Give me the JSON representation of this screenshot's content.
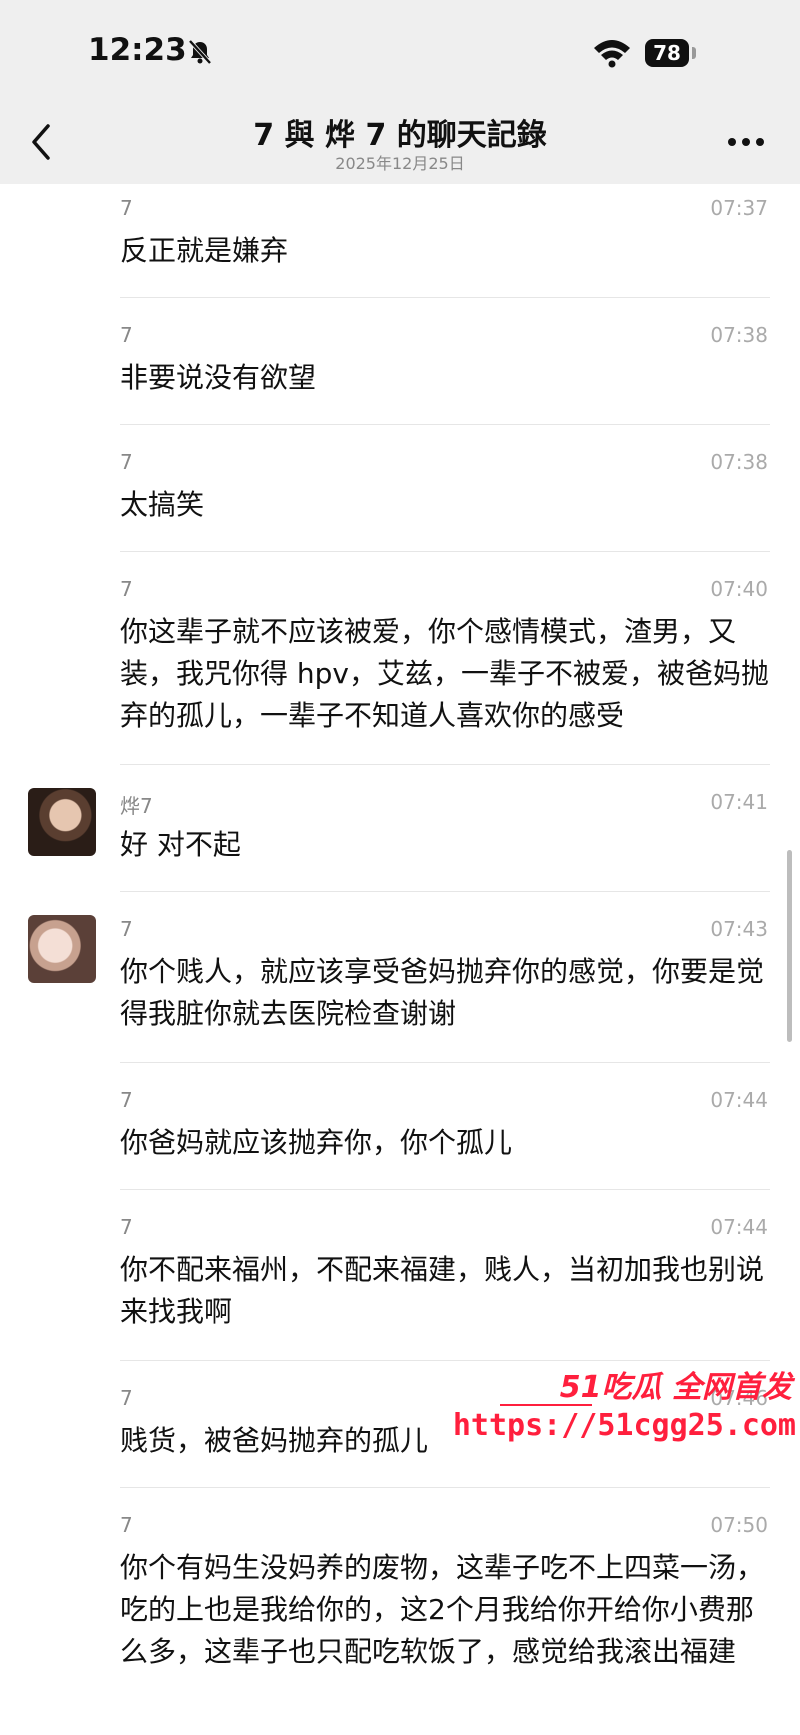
{
  "status_bar": {
    "time": "12:23",
    "battery": "78"
  },
  "header": {
    "title": "7 與 烨 7 的聊天記錄",
    "date": "2025年12月25日"
  },
  "messages": [
    {
      "sender": "7",
      "time": "07:37",
      "text": "反正就是嫌弃"
    },
    {
      "sender": "7",
      "time": "07:38",
      "text": "非要说没有欲望"
    },
    {
      "sender": "7",
      "time": "07:38",
      "text": "太搞笑"
    },
    {
      "sender": "7",
      "time": "07:40",
      "text": "你这辈子就不应该被爱，你个感情模式，渣男，又装，我咒你得 hpv，艾兹，一辈子不被爱，被爸妈抛弃的孤儿，一辈子不知道人喜欢你的感受"
    },
    {
      "sender": "烨7",
      "time": "07:41",
      "text": "好 对不起"
    },
    {
      "sender": "7",
      "time": "07:43",
      "text": "你个贱人，就应该享受爸妈抛弃你的感觉，你要是觉得我脏你就去医院检查谢谢"
    },
    {
      "sender": "7",
      "time": "07:44",
      "text": "你爸妈就应该抛弃你，你个孤儿"
    },
    {
      "sender": "7",
      "time": "07:44",
      "text": "你不配来福州，不配来福建，贱人，当初加我也别说来找我啊"
    },
    {
      "sender": "7",
      "time": "07:46",
      "text": "贱货，被爸妈抛弃的孤儿"
    },
    {
      "sender": "7",
      "time": "07:50",
      "text": "你个有妈生没妈养的废物，这辈子吃不上四菜一汤，吃的上也是我给你的，这2个月我给你开给你小费那么多，这辈子也只配吃软饭了，感觉给我滚出福建"
    }
  ],
  "watermark": {
    "brand": "51吃瓜 全网首发",
    "url": "https://51cgg25.com"
  }
}
